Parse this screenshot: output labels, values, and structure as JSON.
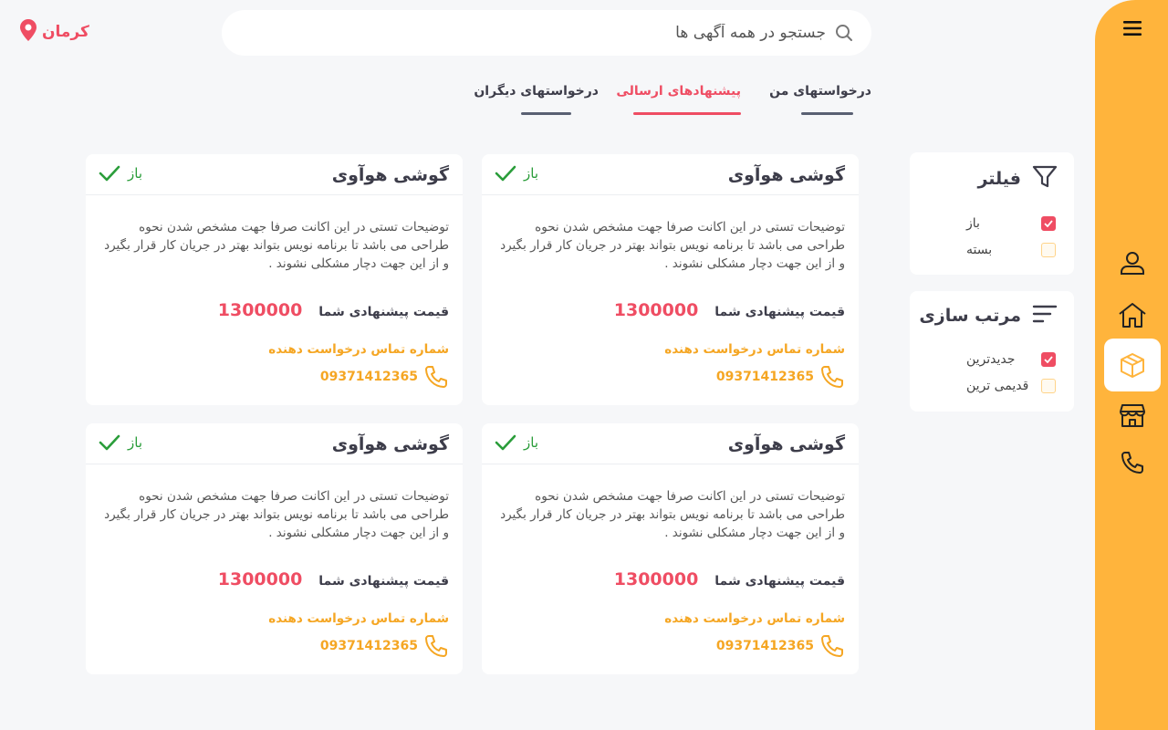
{
  "location": {
    "city": "کرمان",
    "icon": "map-pin-icon"
  },
  "search": {
    "placeholder": "جستجو در همه آگهی ها"
  },
  "tabs": [
    {
      "label": "درخواستهای من",
      "active": false
    },
    {
      "label": "پیشنهادهای ارسالی",
      "active": true
    },
    {
      "label": "درخواستهای دیگران",
      "active": false
    }
  ],
  "filter": {
    "title": "فیلتر",
    "options": [
      {
        "label": "باز",
        "checked": true
      },
      {
        "label": "بسته",
        "checked": false
      }
    ]
  },
  "sort": {
    "title": "مرتب سازی",
    "options": [
      {
        "label": "جدیدترین",
        "checked": true
      },
      {
        "label": "قدیمی ترین",
        "checked": false
      }
    ]
  },
  "sidebar": {
    "items": [
      "menu-icon",
      "user-icon",
      "home-icon",
      "box-icon",
      "store-icon",
      "phone-icon"
    ],
    "active": "box-icon"
  },
  "cards": [
    {
      "title": "گوشی هوآوی",
      "status": "باز",
      "description": "توضیحات تستی در این اکانت صرفا جهت مشخص شدن نحوه طراحی می باشد تا برنامه نویس بتواند بهتر در جریان کار قرار بگیرد و از این جهت دچار مشکلی نشوند .",
      "price_label": "قیمت پیشنهادی شما",
      "price": "1300000",
      "contact_label": "شماره تماس درخواست دهنده",
      "phone": "09371412365"
    },
    {
      "title": "گوشی هوآوی",
      "status": "باز",
      "description": "توضیحات تستی در این اکانت صرفا جهت مشخص شدن نحوه طراحی می باشد تا برنامه نویس بتواند بهتر در جریان کار قرار بگیرد و از این جهت دچار مشکلی نشوند .",
      "price_label": "قیمت پیشنهادی شما",
      "price": "1300000",
      "contact_label": "شماره تماس درخواست دهنده",
      "phone": "09371412365"
    },
    {
      "title": "گوشی هوآوی",
      "status": "باز",
      "description": "توضیحات تستی در این اکانت صرفا جهت مشخص شدن نحوه طراحی می باشد تا برنامه نویس بتواند بهتر در جریان کار قرار بگیرد و از این جهت دچار مشکلی نشوند .",
      "price_label": "قیمت پیشنهادی شما",
      "price": "1300000",
      "contact_label": "شماره تماس درخواست دهنده",
      "phone": "09371412365"
    },
    {
      "title": "گوشی هوآوی",
      "status": "باز",
      "description": "توضیحات تستی در این اکانت صرفا جهت مشخص شدن نحوه طراحی می باشد تا برنامه نویس بتواند بهتر در جریان کار قرار بگیرد و از این جهت دچار مشکلی نشوند .",
      "price_label": "قیمت پیشنهادی شما",
      "price": "1300000",
      "contact_label": "شماره تماس درخواست دهنده",
      "phone": "09371412365"
    }
  ],
  "colors": {
    "accent": "#ffb43c",
    "brand_red": "#ef4d63",
    "open_green": "#2a9d3a",
    "phone_orange": "#f5a623"
  }
}
